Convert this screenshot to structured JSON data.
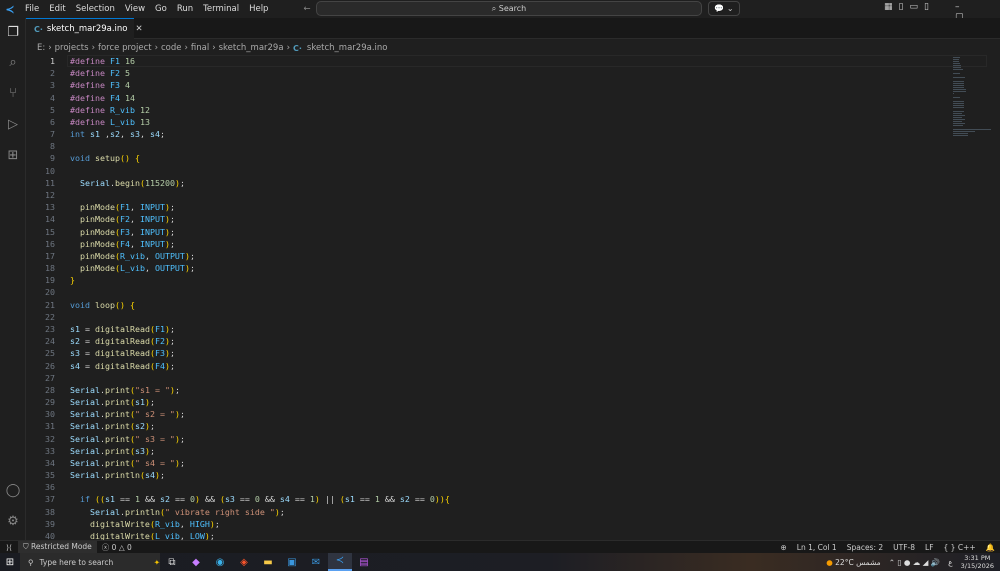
{
  "titlebar": {
    "menus": [
      "File",
      "Edit",
      "Selection",
      "View",
      "Go",
      "Run",
      "Terminal",
      "Help"
    ],
    "search": "Search"
  },
  "tab": {
    "label": "sketch_mar29a.ino"
  },
  "breadcrumbs": [
    "E:",
    "projects",
    "force project",
    "code",
    "final",
    "sketch_mar29a",
    "sketch_mar29a.ino"
  ],
  "editor": {
    "current_line": 1,
    "lines": [
      "#define F1 16",
      "#define F2 5",
      "#define F3 4",
      "#define F4 14",
      "#define R_vib 12",
      "#define L_vib 13",
      "int s1 ,s2, s3, s4;",
      "",
      "void setup() {",
      "",
      "  Serial.begin(115200);",
      "",
      "  pinMode(F1, INPUT);",
      "  pinMode(F2, INPUT);",
      "  pinMode(F3, INPUT);",
      "  pinMode(F4, INPUT);",
      "  pinMode(R_vib, OUTPUT);",
      "  pinMode(L_vib, OUTPUT);",
      "}",
      "",
      "void loop() {",
      "",
      "s1 = digitalRead(F1);",
      "s2 = digitalRead(F2);",
      "s3 = digitalRead(F3);",
      "s4 = digitalRead(F4);",
      "",
      "Serial.print(\"s1 = \");",
      "Serial.print(s1);",
      "Serial.print(\" s2 = \");",
      "Serial.print(s2);",
      "Serial.print(\" s3 = \");",
      "Serial.print(s3);",
      "Serial.print(\" s4 = \");",
      "Serial.println(s4);",
      "",
      "  if ((s1 == 1 && s2 == 0) && (s3 == 0 && s4 == 1) || (s1 == 1 && s2 == 0)){",
      "    Serial.println(\" vibrate right side \");",
      "    digitalWrite(R_vib, HIGH);",
      "    digitalWrite(L_vib, LOW);"
    ]
  },
  "status": {
    "mode": "Restricted Mode",
    "errors": "0",
    "warnings": "0",
    "position": "Ln 1, Col 1",
    "spaces": "Spaces: 2",
    "encoding": "UTF-8",
    "eol": "LF",
    "language": "C++"
  },
  "taskbar": {
    "search": "Type here to search",
    "weather": "22°C",
    "weather_text": "مشمس",
    "lang": "ع",
    "time": "3:31 PM",
    "date": "3/15/2026"
  }
}
